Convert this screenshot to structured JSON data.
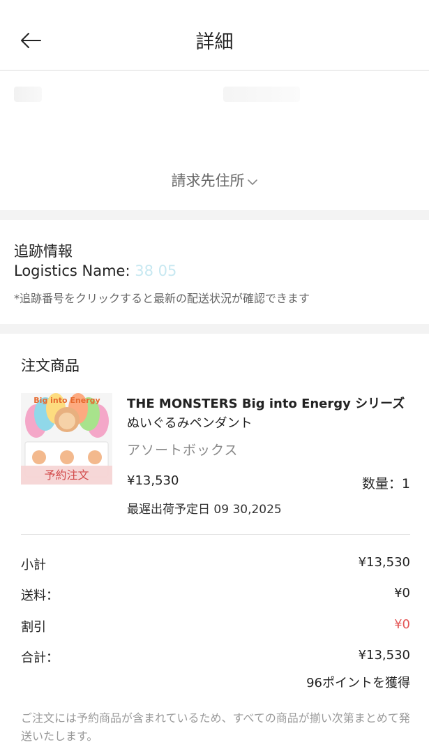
{
  "header": {
    "title": "詳細",
    "back_icon": "arrow-left-icon"
  },
  "billing": {
    "link_label": "請求先住所"
  },
  "tracking": {
    "title": "追跡情報",
    "logistics_label": "Logistics Name:",
    "tracking_number": "38 05",
    "note": "*追跡番号をクリックすると最新の配送状況が確認できます"
  },
  "order": {
    "section_title": "注文商品",
    "product": {
      "name": "THE MONSTERS Big into Energy シリーズ",
      "name_sub": "ぬいぐるみペンダント",
      "variant": "アソートボックス",
      "tag": "予約注文",
      "price": "¥13,530",
      "quantity": "数量：1",
      "ship_date": "最遅出荷予定日 09 30,2025",
      "thumb_logo": "Big into Energy"
    }
  },
  "summary": {
    "subtotal_label": "小計",
    "subtotal_value": "¥13,530",
    "shipping_label": "送料：",
    "shipping_value": "¥0",
    "discount_label": "割引",
    "discount_value": "¥0",
    "total_label": "合計：",
    "total_value": "¥13,530",
    "points": "96ポイントを獲得"
  },
  "notice": "ご注文には予約商品が含まれているため、すべての商品が揃い次第まとめて発送いたします。",
  "colors": {
    "discount": "#e35555",
    "tag_bg": "#f6d5d5",
    "tag_text": "#d24a4a",
    "tracking_link": "#9ad6e6"
  }
}
